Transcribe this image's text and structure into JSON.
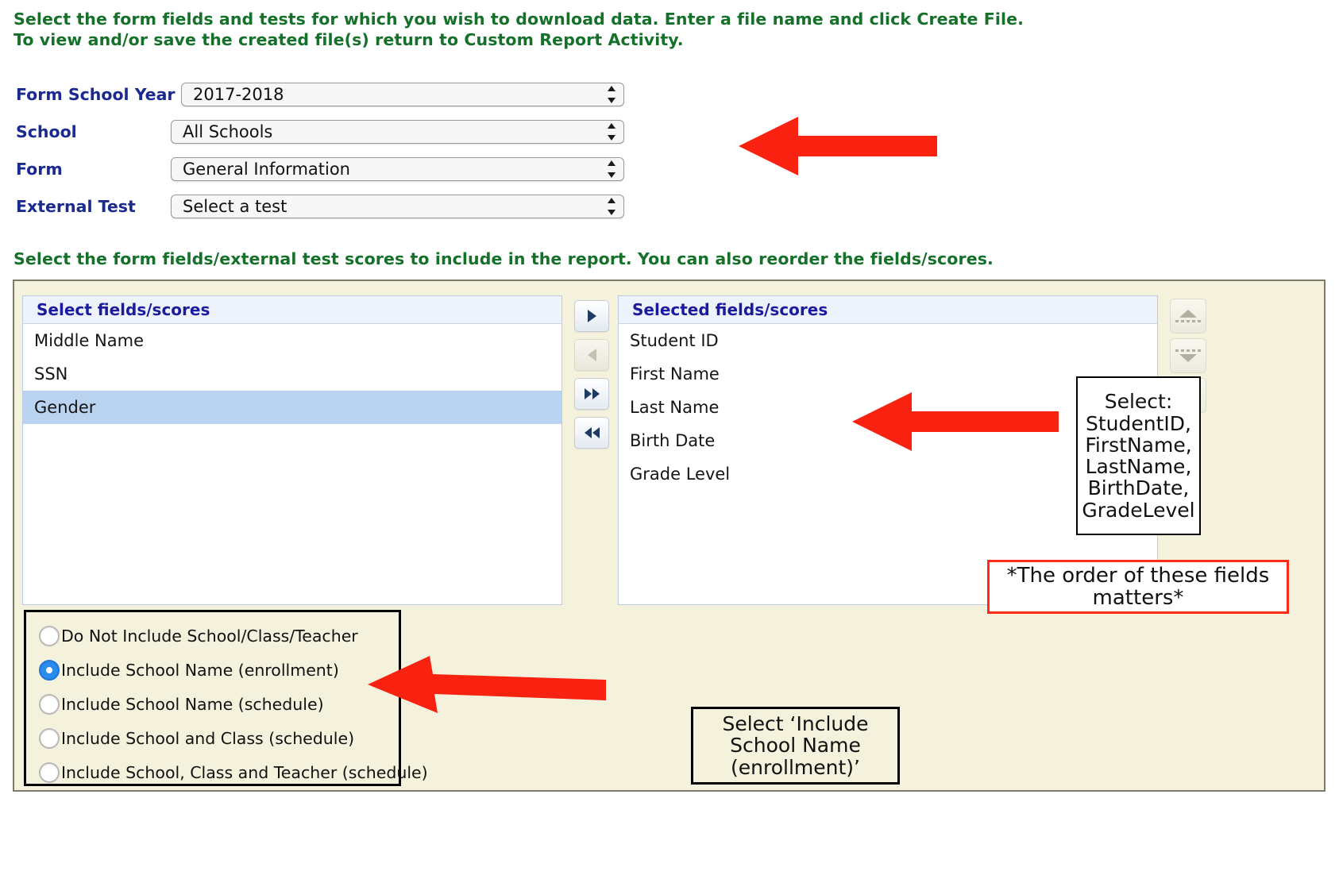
{
  "instructions": {
    "line1": "Select the form fields and tests for which you wish to download data. Enter a file name and click Create File.",
    "line2": "To view and/or save the created file(s) return to Custom Report Activity.",
    "fields_line": "Select the form fields/external test scores to include in the report. You can also reorder the fields/scores."
  },
  "form": {
    "rows": [
      {
        "label": "Form School Year",
        "value": "2017-2018"
      },
      {
        "label": "School",
        "value": "All Schools"
      },
      {
        "label": "Form",
        "value": "General Information"
      },
      {
        "label": "External Test",
        "value": "Select a test"
      }
    ]
  },
  "available": {
    "header": "Select fields/scores",
    "items": [
      {
        "label": "Middle Name",
        "selected": false
      },
      {
        "label": "SSN",
        "selected": false
      },
      {
        "label": "Gender",
        "selected": true
      }
    ]
  },
  "selected": {
    "header": "Selected fields/scores",
    "items": [
      {
        "label": "Student ID"
      },
      {
        "label": "First Name"
      },
      {
        "label": "Last Name"
      },
      {
        "label": "Birth Date"
      },
      {
        "label": "Grade Level"
      }
    ]
  },
  "transfer_buttons": [
    {
      "name": "move-right-button",
      "icon": "caret-right-icon",
      "enabled": true
    },
    {
      "name": "move-left-button",
      "icon": "caret-left-icon",
      "enabled": false
    },
    {
      "name": "move-all-right-button",
      "icon": "double-caret-right-icon",
      "enabled": true
    },
    {
      "name": "move-all-left-button",
      "icon": "double-caret-left-icon",
      "enabled": true
    }
  ],
  "order_buttons": [
    {
      "name": "move-up-button",
      "icon": "caret-up-icon",
      "enabled": false
    },
    {
      "name": "move-down-button",
      "icon": "caret-down-icon",
      "enabled": false
    },
    {
      "name": "remove-button",
      "icon": "close-x-icon",
      "enabled": false
    }
  ],
  "radio_group": {
    "options": [
      {
        "label": "Do Not Include School/Class/Teacher",
        "checked": false
      },
      {
        "label": "Include School Name (enrollment)",
        "checked": true
      },
      {
        "label": "Include School Name (schedule)",
        "checked": false
      },
      {
        "label": "Include School and Class (schedule)",
        "checked": false
      },
      {
        "label": "Include School, Class and Teacher (schedule)",
        "checked": false
      }
    ]
  },
  "annotations": {
    "select_fields": "Select:\nStudentID,\nFirstName,\nLastName,\nBirthDate,\nGradeLevel",
    "select_fields_lines": [
      "Select:",
      "StudentID,",
      "FirstName,",
      "LastName,",
      "BirthDate,",
      "GradeLevel"
    ],
    "order_matters_lines": [
      "*The order of these fields",
      "matters*"
    ],
    "radio_hint_lines": [
      "Select ‘Include",
      "School Name",
      "(enrollment)’"
    ]
  },
  "colors": {
    "instruction_green": "#15712a",
    "label_blue": "#1b2a8f",
    "panel_beige": "#f4f2dc",
    "list_header_blue": "#eef2fb",
    "list_selected_blue": "#b9d3f0",
    "arrow_red": "#f92211",
    "radio_accent": "#2b8cf0",
    "note_border_red": "#ff2a18"
  }
}
